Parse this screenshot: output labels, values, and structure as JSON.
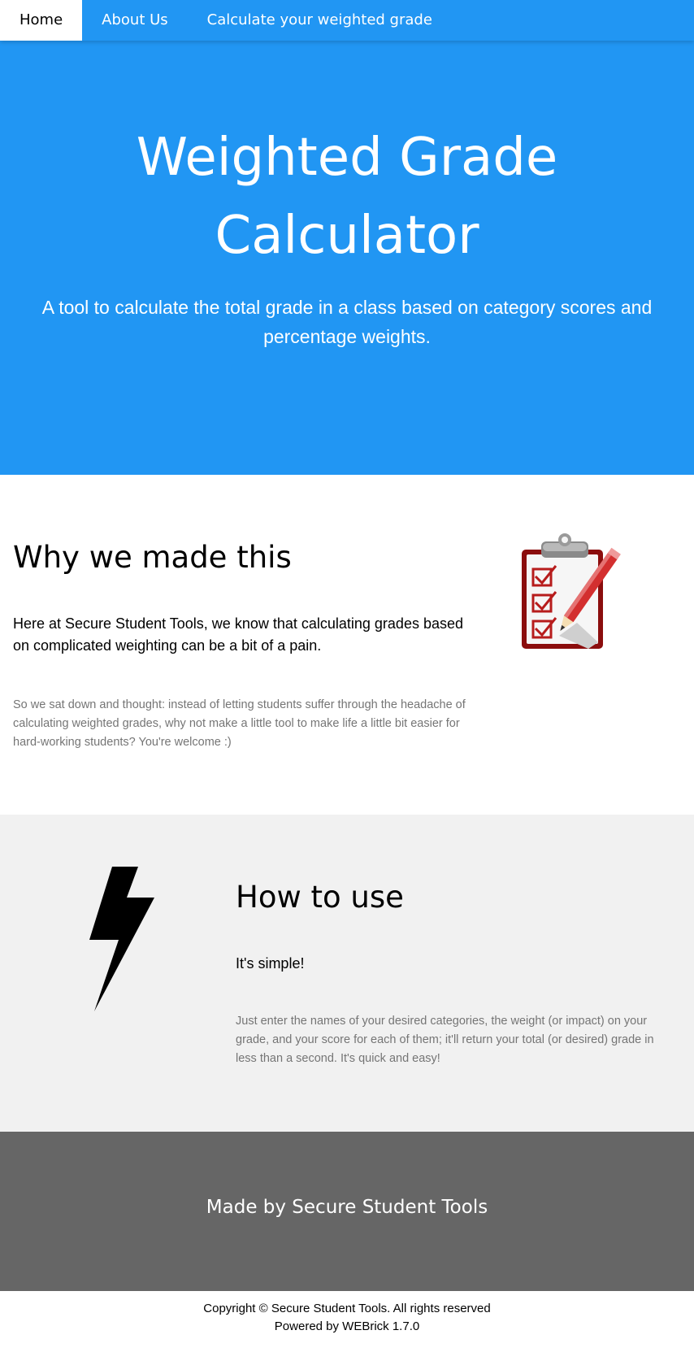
{
  "nav": {
    "items": [
      {
        "label": "Home",
        "active": true
      },
      {
        "label": "About Us",
        "active": false
      },
      {
        "label": "Calculate your weighted grade",
        "active": false
      }
    ]
  },
  "hero": {
    "title": "Weighted Grade Calculator",
    "subtitle": "A tool to calculate the total grade in a class based on category scores and percentage weights."
  },
  "why": {
    "heading": "Why we made this",
    "lead": "Here at Secure Student Tools, we know that calculating grades based on complicated weighting can be a bit of a pain.",
    "body": "So we sat down and thought: instead of letting students suffer through the headache of calculating weighted grades, why not make a little tool to make life a little bit easier for hard-working students? You're welcome :)",
    "icon": "clipboard-checklist-icon"
  },
  "how": {
    "heading": "How to use",
    "lead": "It's simple!",
    "body": "Just enter the names of your desired categories, the weight (or impact) on your grade, and your score for each of them; it'll return your total (or desired) grade in less than a second. It's quick and easy!",
    "icon": "lightning-bolt-icon"
  },
  "footer": {
    "made_by": "Made by Secure Student Tools",
    "copyright": "Copyright © Secure Student Tools. All rights reserved",
    "powered_by": "Powered by WEBrick 1.7.0"
  },
  "colors": {
    "primary": "#2196f3",
    "light_section": "#f1f1f1",
    "footer": "#666666",
    "muted_text": "#757575"
  }
}
